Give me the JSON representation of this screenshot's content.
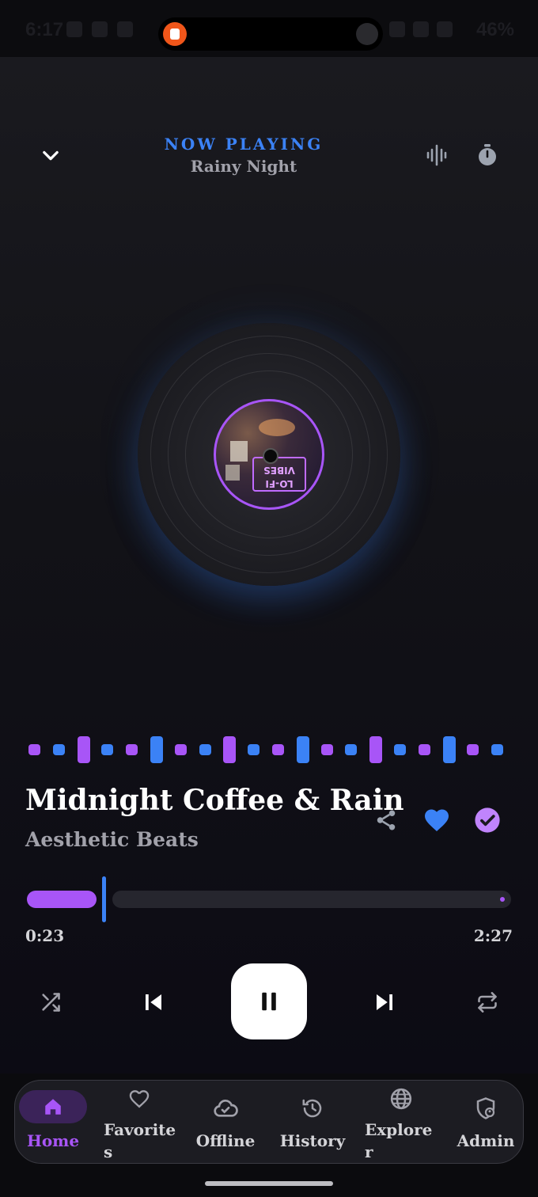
{
  "status_bar": {
    "time": "6:17",
    "battery": "46%"
  },
  "header": {
    "label": "NOW PLAYING",
    "subtitle": "Rainy Night",
    "icons": {
      "collapse": "chevron-down-icon",
      "visualizer": "waveform-icon",
      "timer": "stopwatch-icon"
    }
  },
  "album_art": {
    "neon_text": "LO-FI VIBES"
  },
  "track": {
    "title": "Midnight Coffee & Rain",
    "artist": "Aesthetic Beats",
    "favorited": true,
    "downloaded": true
  },
  "progress": {
    "current": "0:23",
    "total": "2:27",
    "fraction": 0.156
  },
  "colors": {
    "accent_purple": "#a855f7",
    "accent_blue": "#3b82f6",
    "background": "#101014"
  },
  "controls": {
    "shuffle": "shuffle-icon",
    "previous": "skip-previous-icon",
    "play_pause": "pause-icon",
    "next": "skip-next-icon",
    "repeat": "repeat-icon"
  },
  "nav": {
    "items": [
      {
        "label": "Home",
        "icon": "home-icon",
        "active": true
      },
      {
        "label": "Favorite\ns",
        "icon": "heart-icon",
        "active": false
      },
      {
        "label": "Offline",
        "icon": "cloud-check-icon",
        "active": false
      },
      {
        "label": "History",
        "icon": "history-icon",
        "active": false
      },
      {
        "label": "Explore\nr",
        "icon": "globe-icon",
        "active": false
      },
      {
        "label": "Admin",
        "icon": "admin-shield-icon",
        "active": false
      }
    ]
  }
}
